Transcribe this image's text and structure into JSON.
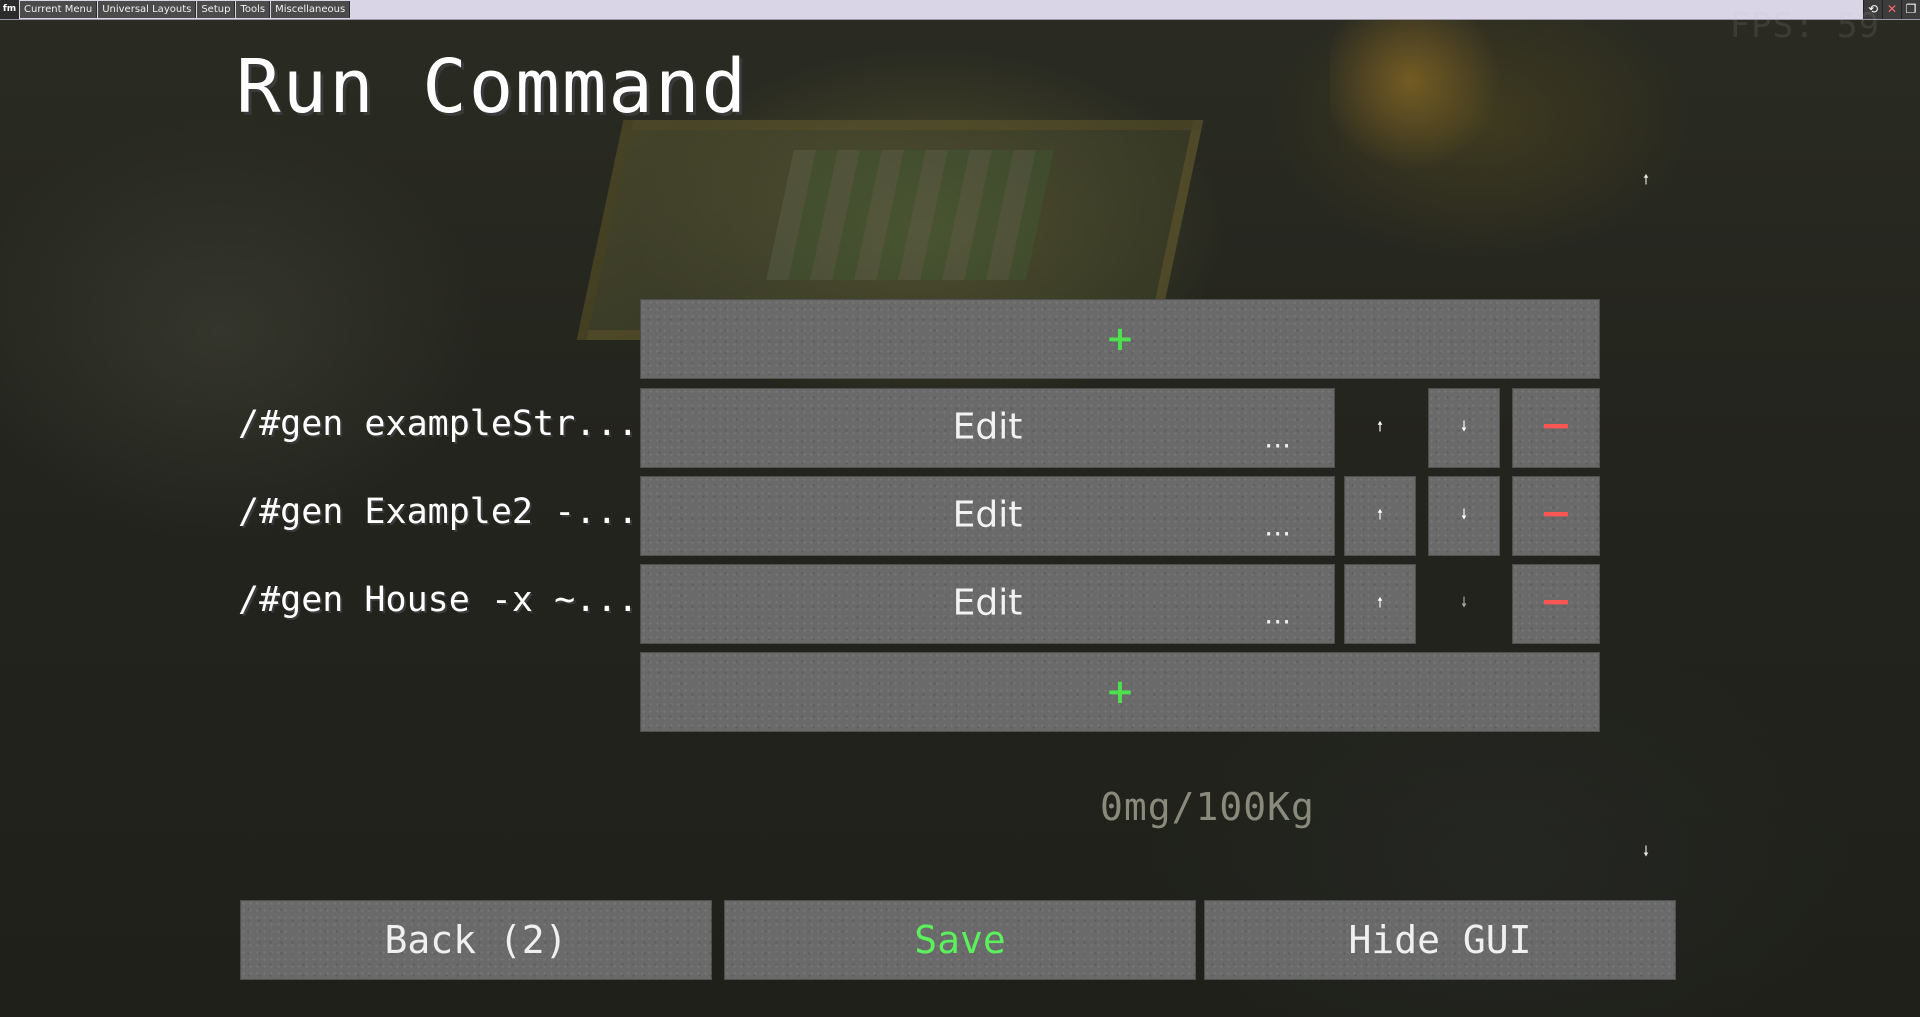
{
  "menubar": {
    "logo": "fm",
    "items": [
      "Current Menu",
      "Universal Layouts",
      "Setup",
      "Tools",
      "Miscellaneous"
    ],
    "window_buttons": [
      "reload-icon",
      "close-icon",
      "restore-icon"
    ]
  },
  "overlay": {
    "fps": "FPS: 59"
  },
  "screen": {
    "title": "Run Command",
    "add_symbol": "+",
    "edit_label": "Edit",
    "more_label": "...",
    "up_symbol": "🠕",
    "down_symbol": "🠗",
    "remove_symbol": "−",
    "commands": [
      {
        "label": "/#gen exampleStr...",
        "up_enabled": false,
        "down_enabled": true
      },
      {
        "label": "/#gen Example2 -...",
        "up_enabled": true,
        "down_enabled": true
      },
      {
        "label": "/#gen House -x ~...",
        "up_enabled": true,
        "down_enabled": false
      }
    ],
    "weight": "0mg/100Kg",
    "scroll_up": "🠕",
    "scroll_down": "🠗"
  },
  "footer": {
    "back_label": "Back (2)",
    "save_label": "Save",
    "hide_label": "Hide GUI"
  },
  "colors": {
    "accent_green": "#5cf05c",
    "remove_red": "#ff5555",
    "button_stone": "#6a6a6a"
  }
}
